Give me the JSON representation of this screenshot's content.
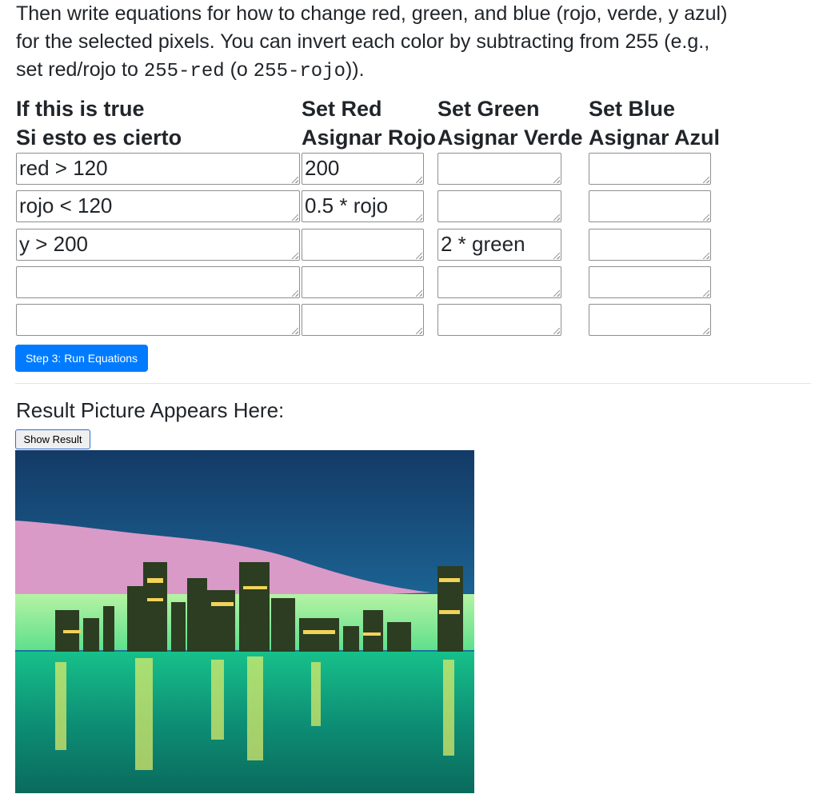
{
  "intro": {
    "line1": "Then write equations for how to change red, green, and blue (rojo, verde, y azul)",
    "line2": "for the selected pixels. You can invert each color by subtracting from 255 (e.g.,",
    "line3_pre": "set red/rojo to ",
    "line3_code1": "255-red",
    "line3_mid": " (o ",
    "line3_code2": "255-rojo",
    "line3_post": "))."
  },
  "columns": {
    "condition": {
      "en": "If this is true",
      "es": "Si esto es cierto"
    },
    "red": {
      "en": "Set Red",
      "es": "Asignar Rojo"
    },
    "green": {
      "en": "Set Green",
      "es": "Asignar Verde"
    },
    "blue": {
      "en": "Set Blue",
      "es": "Asignar Azul"
    }
  },
  "rows": [
    {
      "condition": "red > 120",
      "red": "200",
      "green": "",
      "blue": ""
    },
    {
      "condition": "rojo < 120",
      "red": "0.5 * rojo",
      "green": "",
      "blue": ""
    },
    {
      "condition": "y > 200",
      "red": "",
      "green": "2 * green",
      "blue": ""
    },
    {
      "condition": "",
      "red": "",
      "green": "",
      "blue": ""
    },
    {
      "condition": "",
      "red": "",
      "green": "",
      "blue": ""
    }
  ],
  "run_button": "Step 3: Run Equations",
  "result": {
    "title": "Result Picture Appears Here:",
    "show_button": "Show Result",
    "image_icon": "city-skyline-image"
  },
  "colors": {
    "primary": "#007bff",
    "text": "#212529"
  }
}
